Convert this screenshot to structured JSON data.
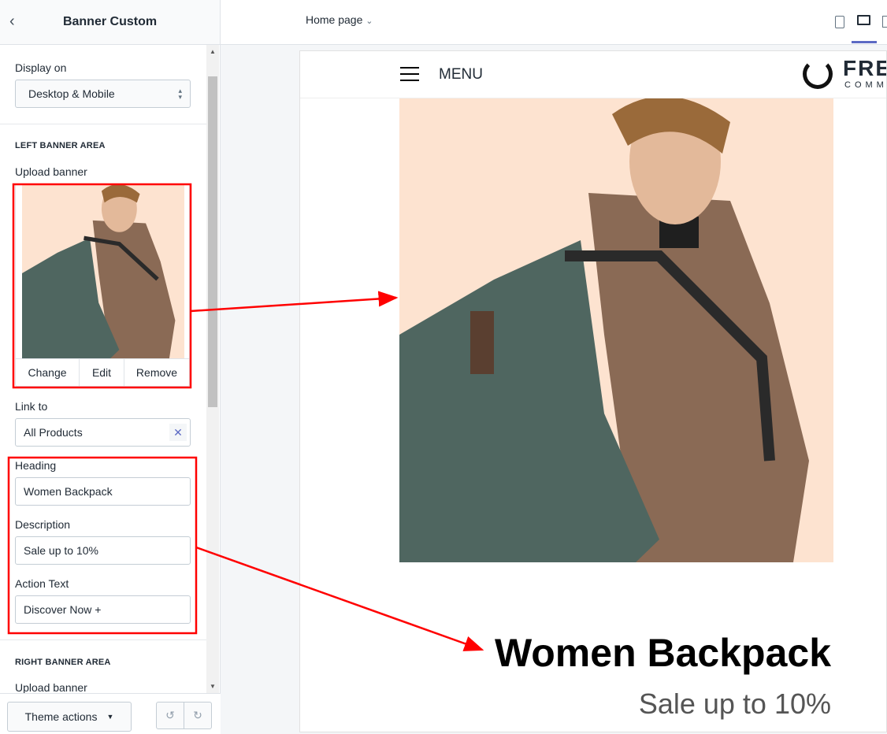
{
  "sidebar": {
    "title": "Banner Custom",
    "display_on_label": "Display on",
    "display_on_value": "Desktop & Mobile",
    "left_section": "LEFT BANNER AREA",
    "upload_label": "Upload banner",
    "change": "Change",
    "edit": "Edit",
    "remove": "Remove",
    "link_label": "Link to",
    "link_value": "All Products",
    "heading_label": "Heading",
    "heading_value": "Women Backpack",
    "description_label": "Description",
    "description_value": "Sale up to 10%",
    "action_label": "Action Text",
    "action_value": "Discover Now +",
    "right_section": "RIGHT BANNER AREA",
    "right_upload_label": "Upload banner"
  },
  "footer": {
    "theme_actions": "Theme actions"
  },
  "topbar": {
    "page_select": "Home page"
  },
  "preview": {
    "menu": "MENU",
    "logo_top": "FRES",
    "logo_bottom": "COMM",
    "heading": "Women Backpack",
    "subheading": "Sale up to 10%"
  },
  "colors": {
    "annotation": "#ff0000",
    "accent": "#5c6ac4",
    "banner_bg": "#fde3d0"
  }
}
